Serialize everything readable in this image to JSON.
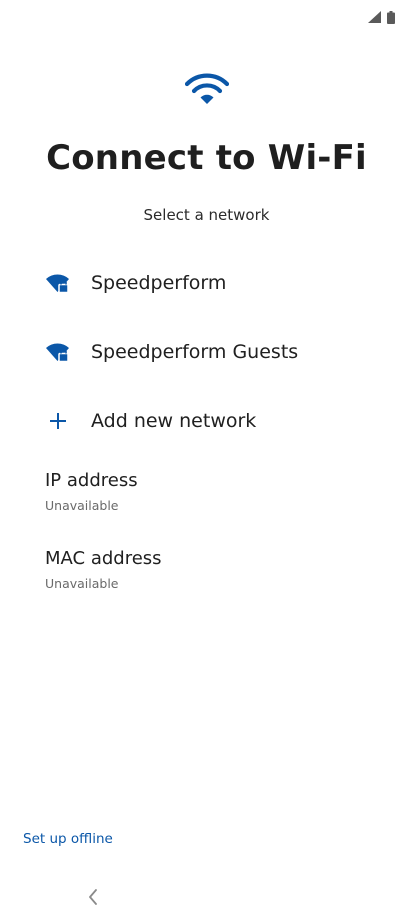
{
  "status_bar": {
    "icons": [
      "signal-icon",
      "battery-icon"
    ]
  },
  "header": {
    "icon": "wifi-icon",
    "title": "Connect to Wi-Fi",
    "subtitle": "Select a network"
  },
  "networks": [
    {
      "name": "Speedperform",
      "icon": "wifi-lock-icon"
    },
    {
      "name": "Speedperform Guests",
      "icon": "wifi-lock-icon"
    }
  ],
  "add_network": {
    "label": "Add new network",
    "icon": "plus-icon"
  },
  "ip_address": {
    "title": "IP address",
    "value": "Unavailable"
  },
  "mac_address": {
    "title": "MAC address",
    "value": "Unavailable"
  },
  "footer": {
    "offline_label": "Set up offline",
    "back_icon": "chevron-left-icon"
  },
  "colors": {
    "accent": "#0b57a8",
    "text": "#1f1f1f",
    "secondary_text": "#6a6a6a"
  }
}
